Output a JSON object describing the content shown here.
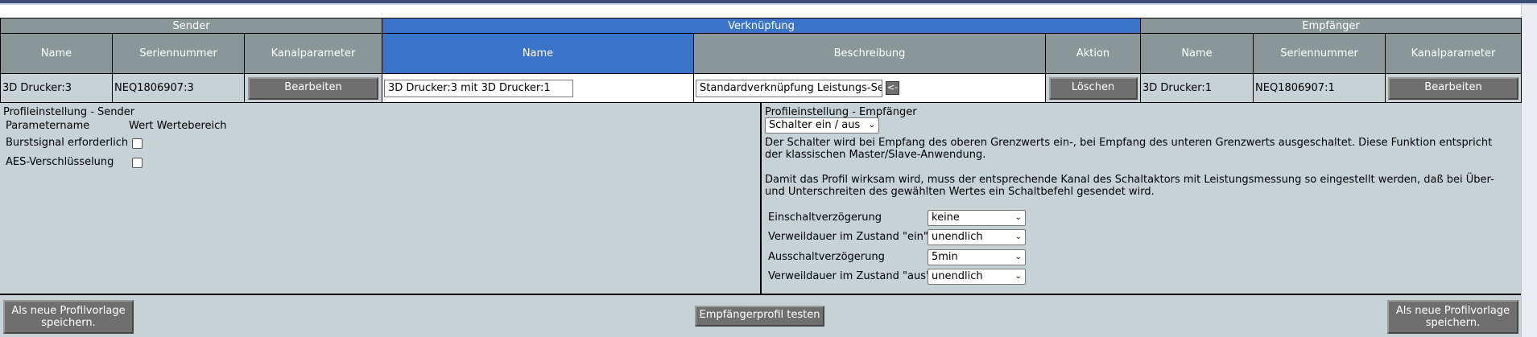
{
  "groups": {
    "sender": "Sender",
    "link": "Verknüpfung",
    "receiver": "Empfänger"
  },
  "headers": {
    "sender_name": "Name",
    "sender_serial": "Seriennummer",
    "sender_param": "Kanalparameter",
    "link_name": "Name",
    "link_desc": "Beschreibung",
    "link_action": "Aktion",
    "recv_name": "Name",
    "recv_serial": "Seriennummer",
    "recv_param": "Kanalparameter"
  },
  "row": {
    "sender_name": "3D Drucker:3",
    "sender_serial": "NEQ1806907:3",
    "sender_edit": "Bearbeiten",
    "link_name_value": "3D Drucker:3 mit 3D Drucker:1",
    "link_desc_value": "Standardverknüpfung Leistungs-Ser",
    "desc_btn": "<-",
    "delete": "Löschen",
    "recv_name": "3D Drucker:1",
    "recv_serial": "NEQ1806907:1",
    "recv_edit": "Bearbeiten"
  },
  "sender_profile": {
    "title": "Profileinstellung - Sender",
    "col_param": "Parametername",
    "col_value": "Wert Wertebereich",
    "burst_label": "Burstsignal erforderlich",
    "aes_label": "AES-Verschlüsselung"
  },
  "receiver_profile": {
    "title": "Profileinstellung - Empfänger",
    "profile_select": "Schalter ein / aus",
    "desc1": "Der Schalter wird bei Empfang des oberen Grenzwerts ein-, bei Empfang des unteren Grenzwerts ausgeschaltet. Diese Funktion entspricht der klassischen Master/Slave-Anwendung.",
    "desc2": "Damit das Profil wirksam wird, muss der entsprechende Kanal des Schaltaktors mit Leistungsmessung so eingestellt werden, daß bei Über- und Unterschreiten des gewählten Wertes ein Schaltbefehl gesendet wird.",
    "params": [
      {
        "label": "Einschaltverzögerung",
        "value": "keine"
      },
      {
        "label": "Verweildauer im Zustand \"ein\"",
        "value": "unendlich"
      },
      {
        "label": "Ausschaltverzögerung",
        "value": "5min"
      },
      {
        "label": "Verweildauer im Zustand \"aus\"",
        "value": "unendlich"
      }
    ]
  },
  "footer": {
    "save_left": "Als neue Profilvorlage speichern.",
    "test": "Empfängerprofil testen",
    "save_right": "Als neue Profilvorlage speichern."
  }
}
